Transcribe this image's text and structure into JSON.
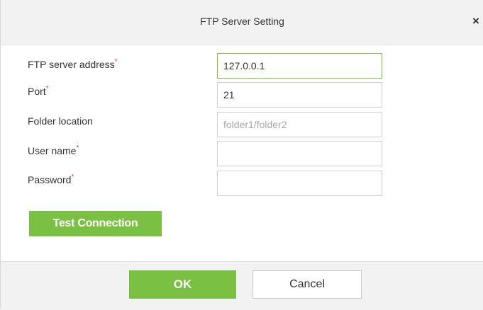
{
  "dialog": {
    "title": "FTP Server Setting",
    "close_glyph": "×"
  },
  "form": {
    "required_marker": "*",
    "address": {
      "label": "FTP server address",
      "required": true,
      "value": "127.0.0.1",
      "placeholder": "",
      "focused": true
    },
    "port": {
      "label": "Port",
      "required": true,
      "value": "21",
      "placeholder": ""
    },
    "folder": {
      "label": "Folder location",
      "required": false,
      "value": "",
      "placeholder": "folder1/folder2"
    },
    "username": {
      "label": "User name",
      "required": true,
      "value": "",
      "placeholder": ""
    },
    "password": {
      "label": "Password",
      "required": true,
      "value": "",
      "placeholder": ""
    },
    "test_button": "Test Connection"
  },
  "footer": {
    "ok_label": "OK",
    "cancel_label": "Cancel"
  },
  "colors": {
    "accent": "#7ac143",
    "required": "#e0463e"
  }
}
